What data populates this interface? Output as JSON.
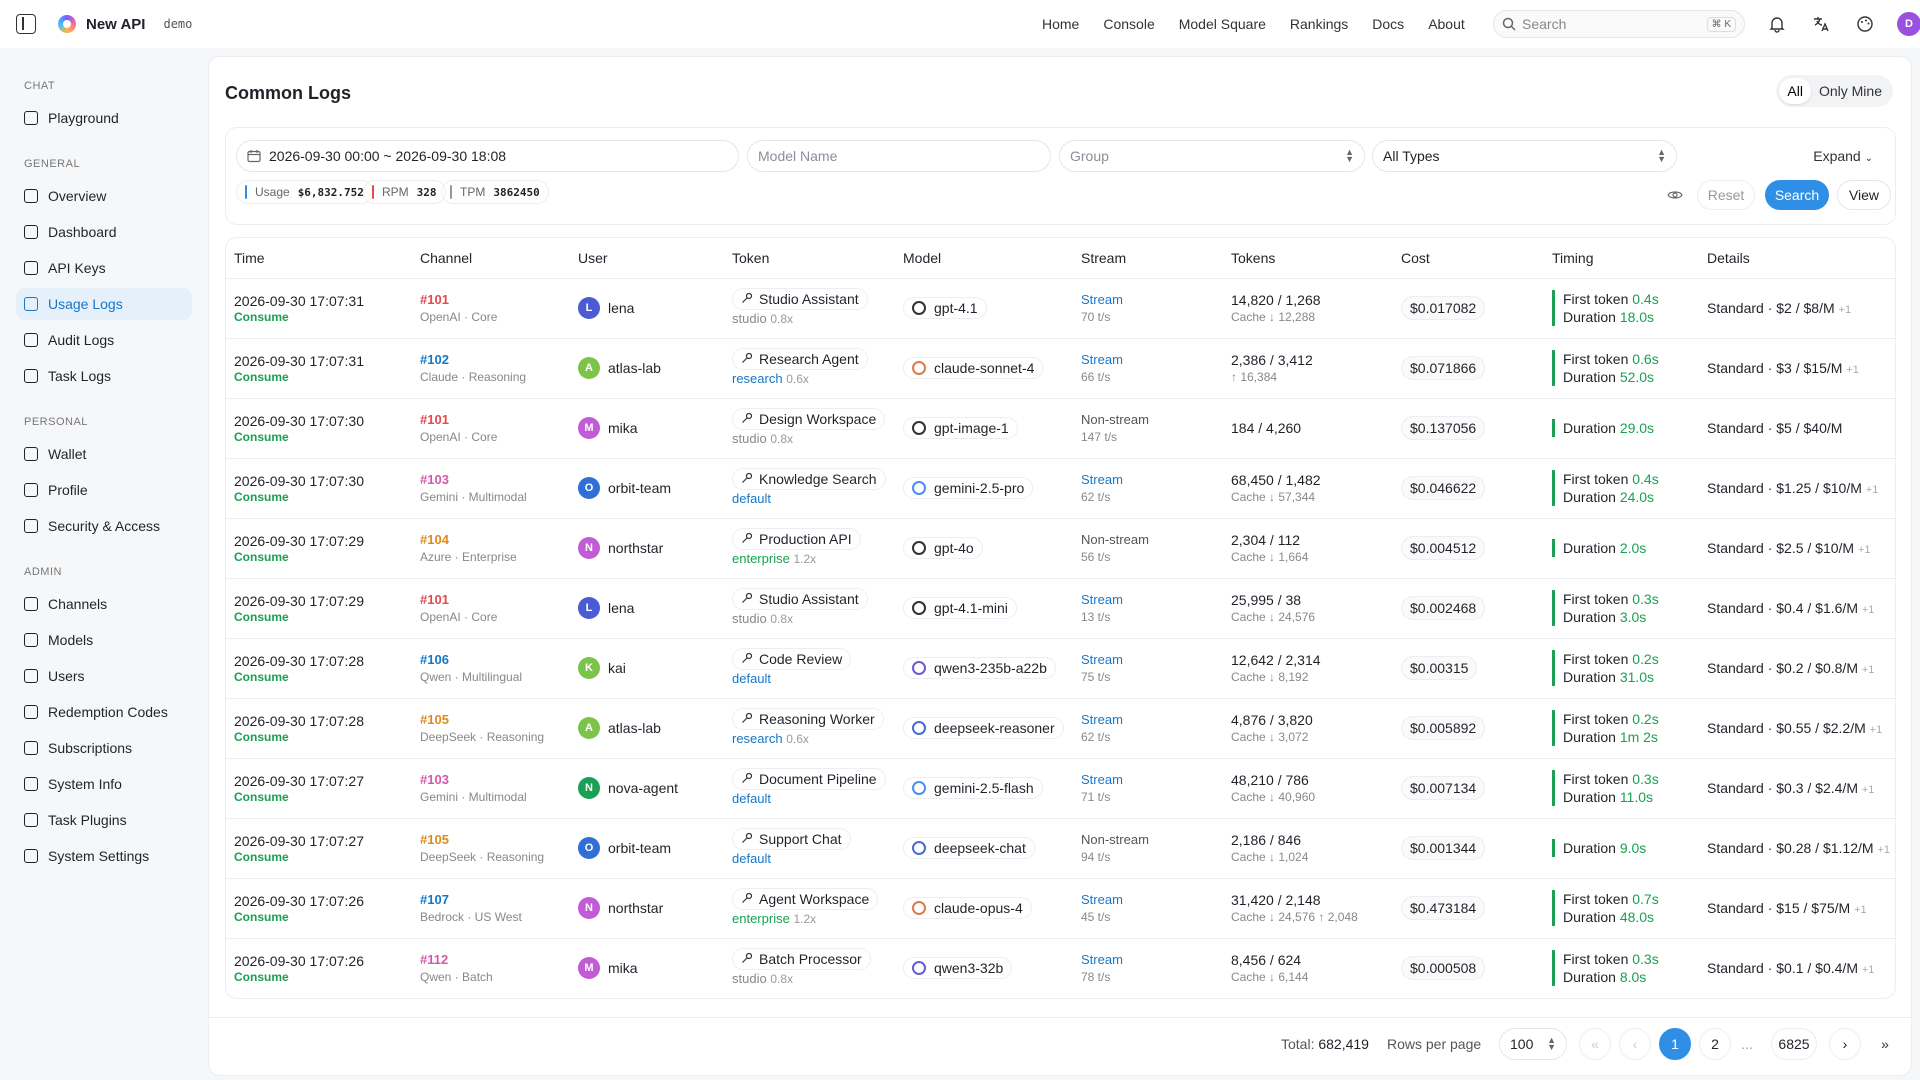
{
  "app": {
    "title": "New API",
    "tag": "demo"
  },
  "nav": [
    "Home",
    "Console",
    "Model Square",
    "Rankings",
    "Docs",
    "About"
  ],
  "search": {
    "placeholder": "Search",
    "shortcut": "⌘ K"
  },
  "user_avatar": "D",
  "sidebar": {
    "sections": [
      {
        "title": "CHAT",
        "items": [
          {
            "label": "Playground",
            "icon": "flask-icon"
          }
        ]
      },
      {
        "title": "GENERAL",
        "items": [
          {
            "label": "Overview",
            "icon": "pulse-icon"
          },
          {
            "label": "Dashboard",
            "icon": "grid-icon"
          },
          {
            "label": "API Keys",
            "icon": "key-icon"
          },
          {
            "label": "Usage Logs",
            "icon": "doc-icon",
            "active": true
          },
          {
            "label": "Audit Logs",
            "icon": "clipboard-icon"
          },
          {
            "label": "Task Logs",
            "icon": "list-icon"
          }
        ]
      },
      {
        "title": "PERSONAL",
        "items": [
          {
            "label": "Wallet",
            "icon": "wallet-icon"
          },
          {
            "label": "Profile",
            "icon": "user-icon"
          },
          {
            "label": "Security & Access",
            "icon": "shield-icon"
          }
        ]
      },
      {
        "title": "ADMIN",
        "items": [
          {
            "label": "Channels",
            "icon": "radio-icon"
          },
          {
            "label": "Models",
            "icon": "cube-icon"
          },
          {
            "label": "Users",
            "icon": "users-icon"
          },
          {
            "label": "Redemption Codes",
            "icon": "ticket-icon"
          },
          {
            "label": "Subscriptions",
            "icon": "card-icon"
          },
          {
            "label": "System Info",
            "icon": "cpu-icon"
          },
          {
            "label": "Task Plugins",
            "icon": "plug-icon"
          },
          {
            "label": "System Settings",
            "icon": "gear-icon"
          }
        ]
      }
    ]
  },
  "page": {
    "title": "Common Logs",
    "scope": [
      "All",
      "Only Mine"
    ]
  },
  "filters": {
    "date_range": "2026-09-30 00:00 ~ 2026-09-30 18:08",
    "model_placeholder": "Model Name",
    "group_placeholder": "Group",
    "type_value": "All Types",
    "expand": "Expand"
  },
  "stats": [
    {
      "label": "Usage",
      "value": "$6,832.752",
      "color": "#2f8fe6"
    },
    {
      "label": "RPM",
      "value": "328",
      "color": "#e5484d"
    },
    {
      "label": "TPM",
      "value": "3862450",
      "color": "#999999"
    }
  ],
  "buttons": {
    "reset": "Reset",
    "search": "Search",
    "view": "View"
  },
  "columns": [
    "Time",
    "Channel",
    "User",
    "Token",
    "Model",
    "Stream",
    "Tokens",
    "Cost",
    "Timing",
    "Details"
  ],
  "rows": [
    {
      "time": "2026-09-30 17:07:31",
      "type": "Consume",
      "chan": "#101",
      "chan_color": "#e5484d",
      "chan_sub": "OpenAI · Core",
      "user": "lena",
      "uinit": "L",
      "ucolor": "#4a5bd4",
      "token": "Studio Assistant",
      "group": "studio",
      "group_color": "#888888",
      "mult": "0.8x",
      "model": "gpt-4.1",
      "micolor": "#333333",
      "stream": "Stream",
      "rate": "70 t/s",
      "tokens": "14,820 / 1,268",
      "tok2": "Cache ↓ 12,288",
      "cost": "$0.017082",
      "ft": "0.4s",
      "dur": "18.0s",
      "details": "Standard · $2 / $8/M",
      "plus": "+1"
    },
    {
      "time": "2026-09-30 17:07:31",
      "type": "Consume",
      "chan": "#102",
      "chan_color": "#1677c9",
      "chan_sub": "Claude · Reasoning",
      "user": "atlas-lab",
      "uinit": "A",
      "ucolor": "#7cc34a",
      "token": "Research Agent",
      "group": "research",
      "group_color": "#1677c9",
      "mult": "0.6x",
      "model": "claude-sonnet-4",
      "micolor": "#e07a4a",
      "stream": "Stream",
      "rate": "66 t/s",
      "tokens": "2,386 / 3,412",
      "tok2": "↑ 16,384",
      "cost": "$0.071866",
      "ft": "0.6s",
      "dur": "52.0s",
      "details": "Standard · $3 / $15/M",
      "plus": "+1"
    },
    {
      "time": "2026-09-30 17:07:30",
      "type": "Consume",
      "chan": "#101",
      "chan_color": "#e5484d",
      "chan_sub": "OpenAI · Core",
      "user": "mika",
      "uinit": "M",
      "ucolor": "#c25bd6",
      "token": "Design Workspace",
      "group": "studio",
      "group_color": "#888888",
      "mult": "0.8x",
      "model": "gpt-image-1",
      "micolor": "#333333",
      "stream": "Non-stream",
      "rate": "147 t/s",
      "tokens": "184 / 4,260",
      "tok2": "",
      "cost": "$0.137056",
      "ft": "",
      "dur": "29.0s",
      "details": "Standard · $5 / $40/M",
      "plus": ""
    },
    {
      "time": "2026-09-30 17:07:30",
      "type": "Consume",
      "chan": "#103",
      "chan_color": "#d658a8",
      "chan_sub": "Gemini · Multimodal",
      "user": "orbit-team",
      "uinit": "O",
      "ucolor": "#2f6fd6",
      "token": "Knowledge Search",
      "group": "default",
      "group_color": "#1677c9",
      "mult": "",
      "model": "gemini-2.5-pro",
      "micolor": "#4b8ef5",
      "stream": "Stream",
      "rate": "62 t/s",
      "tokens": "68,450 / 1,482",
      "tok2": "Cache ↓ 57,344",
      "cost": "$0.046622",
      "ft": "0.4s",
      "dur": "24.0s",
      "details": "Standard · $1.25 / $10/M",
      "plus": "+1"
    },
    {
      "time": "2026-09-30 17:07:29",
      "type": "Consume",
      "chan": "#104",
      "chan_color": "#e08a1a",
      "chan_sub": "Azure · Enterprise",
      "user": "northstar",
      "uinit": "N",
      "ucolor": "#c25bd6",
      "token": "Production API",
      "group": "enterprise",
      "group_color": "#1aa052",
      "mult": "1.2x",
      "model": "gpt-4o",
      "micolor": "#333333",
      "stream": "Non-stream",
      "rate": "56 t/s",
      "tokens": "2,304 / 112",
      "tok2": "Cache ↓ 1,664",
      "cost": "$0.004512",
      "ft": "",
      "dur": "2.0s",
      "details": "Standard · $2.5 / $10/M",
      "plus": "+1"
    },
    {
      "time": "2026-09-30 17:07:29",
      "type": "Consume",
      "chan": "#101",
      "chan_color": "#e5484d",
      "chan_sub": "OpenAI · Core",
      "user": "lena",
      "uinit": "L",
      "ucolor": "#4a5bd4",
      "token": "Studio Assistant",
      "group": "studio",
      "group_color": "#888888",
      "mult": "0.8x",
      "model": "gpt-4.1-mini",
      "micolor": "#333333",
      "stream": "Stream",
      "rate": "13 t/s",
      "tokens": "25,995 / 38",
      "tok2": "Cache ↓ 24,576",
      "cost": "$0.002468",
      "ft": "0.3s",
      "dur": "3.0s",
      "details": "Standard · $0.4 / $1.6/M",
      "plus": "+1"
    },
    {
      "time": "2026-09-30 17:07:28",
      "type": "Consume",
      "chan": "#106",
      "chan_color": "#1677c9",
      "chan_sub": "Qwen · Multilingual",
      "user": "kai",
      "uinit": "K",
      "ucolor": "#7cc34a",
      "token": "Code Review",
      "group": "default",
      "group_color": "#1677c9",
      "mult": "",
      "model": "qwen3-235b-a22b",
      "micolor": "#6a5cd6",
      "stream": "Stream",
      "rate": "75 t/s",
      "tokens": "12,642 / 2,314",
      "tok2": "Cache ↓ 8,192",
      "cost": "$0.00315",
      "ft": "0.2s",
      "dur": "31.0s",
      "details": "Standard · $0.2 / $0.8/M",
      "plus": "+1"
    },
    {
      "time": "2026-09-30 17:07:28",
      "type": "Consume",
      "chan": "#105",
      "chan_color": "#e08a1a",
      "chan_sub": "DeepSeek · Reasoning",
      "user": "atlas-lab",
      "uinit": "A",
      "ucolor": "#7cc34a",
      "token": "Reasoning Worker",
      "group": "research",
      "group_color": "#1677c9",
      "mult": "0.6x",
      "model": "deepseek-reasoner",
      "micolor": "#4a6bd6",
      "stream": "Stream",
      "rate": "62 t/s",
      "tokens": "4,876 / 3,820",
      "tok2": "Cache ↓ 3,072",
      "cost": "$0.005892",
      "ft": "0.2s",
      "dur": "1m 2s",
      "details": "Standard · $0.55 / $2.2/M",
      "plus": "+1"
    },
    {
      "time": "2026-09-30 17:07:27",
      "type": "Consume",
      "chan": "#103",
      "chan_color": "#d658a8",
      "chan_sub": "Gemini · Multimodal",
      "user": "nova-agent",
      "uinit": "N",
      "ucolor": "#1aa052",
      "token": "Document Pipeline",
      "group": "default",
      "group_color": "#1677c9",
      "mult": "",
      "model": "gemini-2.5-flash",
      "micolor": "#4b8ef5",
      "stream": "Stream",
      "rate": "71 t/s",
      "tokens": "48,210 / 786",
      "tok2": "Cache ↓ 40,960",
      "cost": "$0.007134",
      "ft": "0.3s",
      "dur": "11.0s",
      "details": "Standard · $0.3 / $2.4/M",
      "plus": "+1"
    },
    {
      "time": "2026-09-30 17:07:27",
      "type": "Consume",
      "chan": "#105",
      "chan_color": "#e08a1a",
      "chan_sub": "DeepSeek · Reasoning",
      "user": "orbit-team",
      "uinit": "O",
      "ucolor": "#2f6fd6",
      "token": "Support Chat",
      "group": "default",
      "group_color": "#1677c9",
      "mult": "",
      "model": "deepseek-chat",
      "micolor": "#4a6bd6",
      "stream": "Non-stream",
      "rate": "94 t/s",
      "tokens": "2,186 / 846",
      "tok2": "Cache ↓ 1,024",
      "cost": "$0.001344",
      "ft": "",
      "dur": "9.0s",
      "details": "Standard · $0.28 / $1.12/M",
      "plus": "+1"
    },
    {
      "time": "2026-09-30 17:07:26",
      "type": "Consume",
      "chan": "#107",
      "chan_color": "#1677c9",
      "chan_sub": "Bedrock · US West",
      "user": "northstar",
      "uinit": "N",
      "ucolor": "#c25bd6",
      "token": "Agent Workspace",
      "group": "enterprise",
      "group_color": "#1aa052",
      "mult": "1.2x",
      "model": "claude-opus-4",
      "micolor": "#e07a4a",
      "stream": "Stream",
      "rate": "45 t/s",
      "tokens": "31,420 / 2,148",
      "tok2": "Cache ↓ 24,576  ↑ 2,048",
      "cost": "$0.473184",
      "ft": "0.7s",
      "dur": "48.0s",
      "details": "Standard · $15 / $75/M",
      "plus": "+1"
    },
    {
      "time": "2026-09-30 17:07:26",
      "type": "Consume",
      "chan": "#112",
      "chan_color": "#d658a8",
      "chan_sub": "Qwen · Batch",
      "user": "mika",
      "uinit": "M",
      "ucolor": "#c25bd6",
      "token": "Batch Processor",
      "group": "studio",
      "group_color": "#888888",
      "mult": "0.8x",
      "model": "qwen3-32b",
      "micolor": "#6a5cd6",
      "stream": "Stream",
      "rate": "78 t/s",
      "tokens": "8,456 / 624",
      "tok2": "Cache ↓ 6,144",
      "cost": "$0.000508",
      "ft": "0.3s",
      "dur": "8.0s",
      "details": "Standard · $0.1 / $0.4/M",
      "plus": "+1"
    }
  ],
  "labels": {
    "first_token": "First token",
    "duration": "Duration"
  },
  "pagination": {
    "total_label": "Total:",
    "total": "682,419",
    "rpp_label": "Rows per page",
    "rpp": "100",
    "pages": [
      "1",
      "2",
      "...",
      "6825"
    ]
  }
}
